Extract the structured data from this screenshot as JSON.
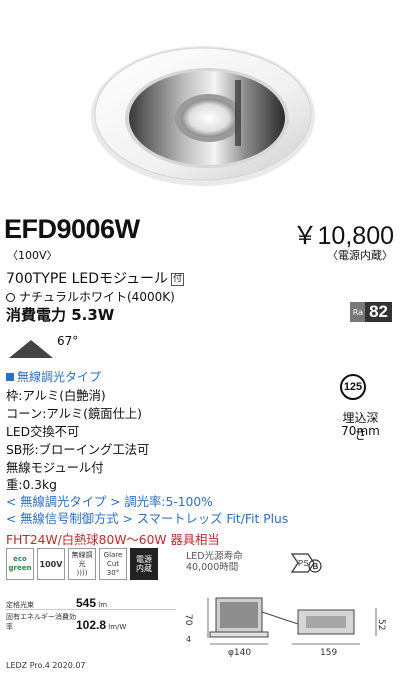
{
  "product": {
    "model": "EFD9006W",
    "voltage": "〈100V〉",
    "price": "￥10,800",
    "price_note": "〈電源内蔵〉",
    "module_type": "700TYPE LEDモジュール",
    "module_badge": "付",
    "color_temp": "ナチュラルホワイト(4000K)",
    "power_label": "消費電力 5.3W",
    "ra_label": "Ra",
    "ra_value": "82",
    "beam_angle": "67°"
  },
  "specs": {
    "type_heading": "無線調光タイプ",
    "frame": "枠:アルミ(白艶消)",
    "cone": "コーン:アルミ(鏡面仕上)",
    "led_replace": "LED交換不可",
    "sb": "SB形:ブローイング工法可",
    "wireless_module": "無線モジュール付",
    "weight": "重:0.3kg",
    "dimming_rate": "< 無線調光タイプ > 調光率:5-100%",
    "control_method": "< 無線信号制御方式 > スマートレッズ Fit/Fit Plus",
    "equivalent": "FHT24W/白熱球80W〜60W 器具相当"
  },
  "cutout": {
    "size": "125",
    "depth_label": "埋込深さ",
    "depth_value": "70mm"
  },
  "icons": [
    {
      "name": "eco-icon",
      "line1": "eco",
      "line2": "green"
    },
    {
      "name": "voltage-icon",
      "line1": "100V",
      "line2": ""
    },
    {
      "name": "wireless-dimming-icon",
      "line1": "無線調光",
      "line2": ""
    },
    {
      "name": "glare-cut-icon",
      "line1": "Glare Cut",
      "line2": "30°"
    },
    {
      "name": "power-builtin-icon",
      "line1": "電源",
      "line2": "内蔵"
    }
  ],
  "life": {
    "line1": "LED光源寿命",
    "line2": "40,000時間"
  },
  "pse": {
    "mark": "PS",
    "sub": "E",
    "b": "B"
  },
  "luminous": {
    "flux_label": "定格光束",
    "flux_value": "545",
    "flux_unit": "lm",
    "efficiency_label": "固有エネルギー消費効率",
    "efficiency_value": "102.8",
    "efficiency_unit": "lm/W"
  },
  "dimensions": {
    "height": "70",
    "diameter": "φ140",
    "width": "159",
    "depth": "52",
    "flange": "4"
  },
  "footer": "LEDZ Pro.4 2020.07",
  "colors": {
    "accent_blue": "#2a6fc9",
    "accent_red": "#c62828"
  }
}
